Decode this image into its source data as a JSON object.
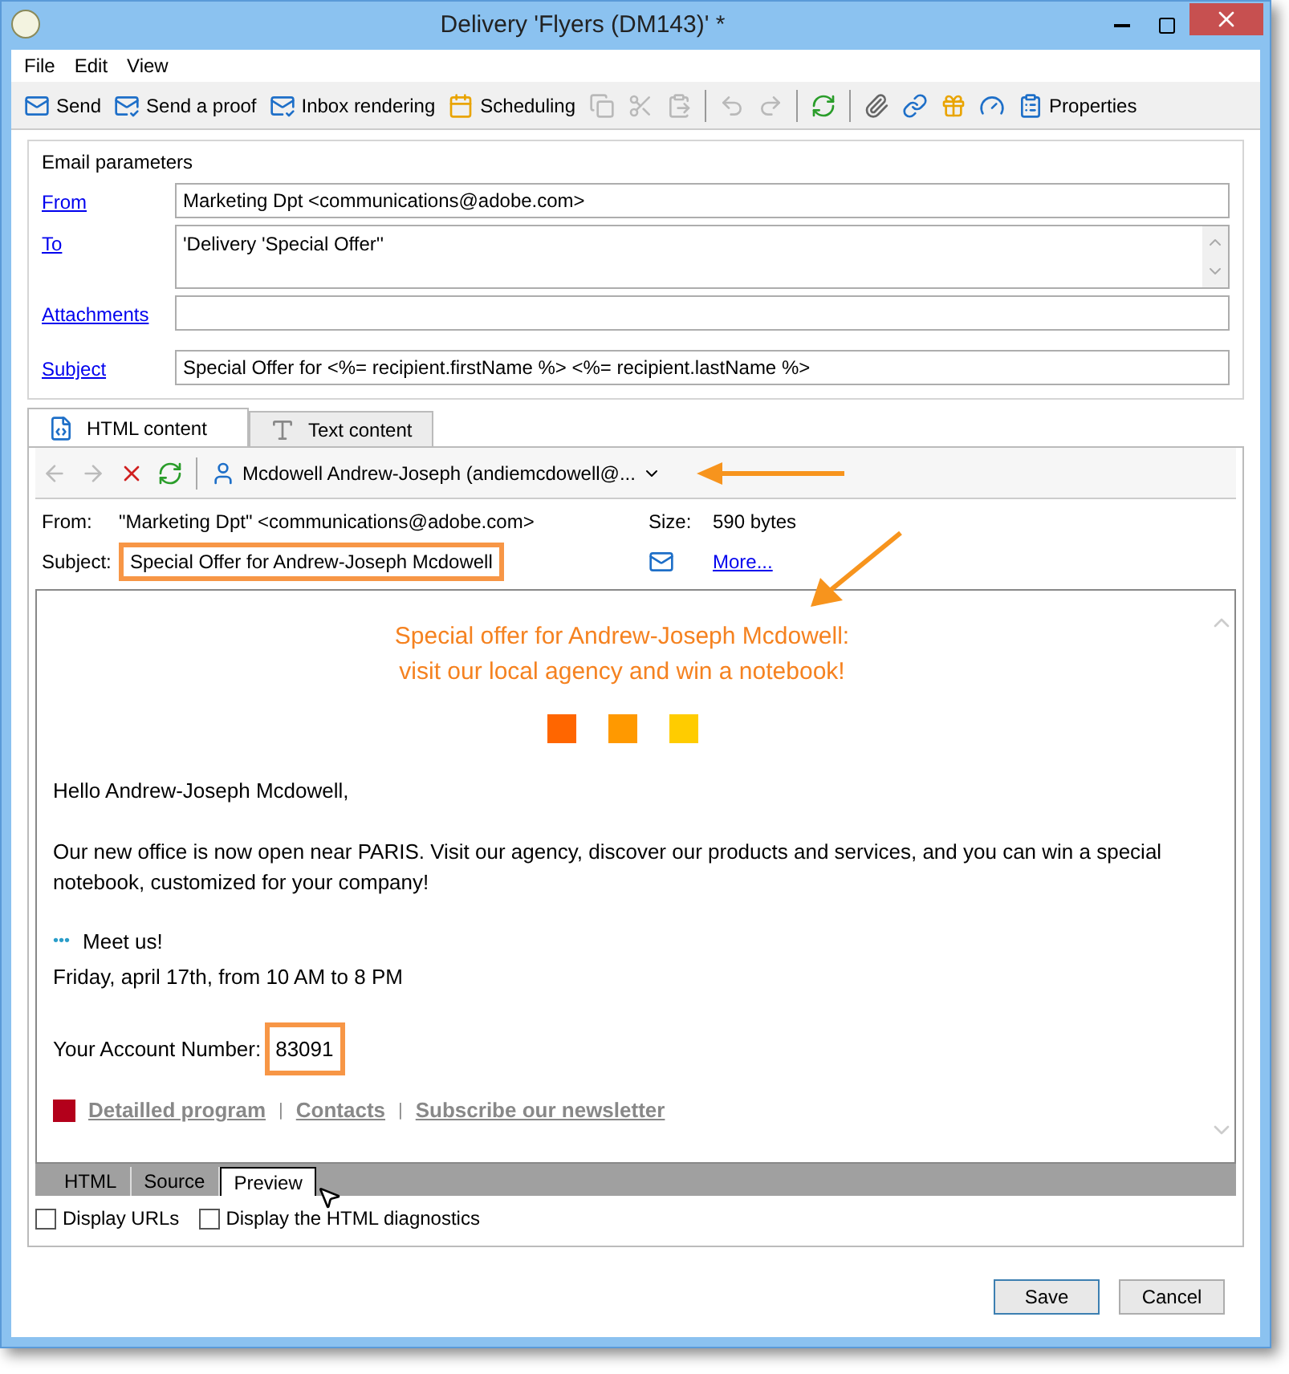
{
  "window": {
    "title": "Delivery 'Flyers (DM143)' *"
  },
  "menu": [
    "File",
    "Edit",
    "View"
  ],
  "toolbar": [
    {
      "kind": "mail",
      "label": "Send",
      "disabled": false
    },
    {
      "kind": "mail-check",
      "label": "Send a proof",
      "disabled": false
    },
    {
      "kind": "mail-check",
      "label": "Inbox rendering",
      "disabled": false
    },
    {
      "kind": "calendar",
      "label": "Scheduling",
      "disabled": false
    },
    {
      "kind": "copy",
      "disabled": true
    },
    {
      "kind": "cut",
      "disabled": true
    },
    {
      "kind": "paste",
      "disabled": true
    },
    {
      "kind": "sep"
    },
    {
      "kind": "undo",
      "disabled": true
    },
    {
      "kind": "redo",
      "disabled": true
    },
    {
      "kind": "sep"
    },
    {
      "kind": "refresh",
      "disabled": false
    },
    {
      "kind": "sep"
    },
    {
      "kind": "paperclip",
      "disabled": false
    },
    {
      "kind": "link",
      "disabled": false
    },
    {
      "kind": "gift",
      "disabled": false
    },
    {
      "kind": "gauge",
      "disabled": false
    },
    {
      "kind": "clipboard",
      "label": "Properties",
      "disabled": false
    }
  ],
  "email_parameters": {
    "title": "Email parameters",
    "fields": [
      {
        "label": "From",
        "value": "Marketing Dpt <communications@adobe.com>",
        "kind": "line"
      },
      {
        "label": "To",
        "value": "'Delivery 'Special Offer''",
        "kind": "multi"
      },
      {
        "label": "Attachments",
        "kind": "line"
      },
      {
        "label": "Subject",
        "value": "Special Offer for <%= recipient.firstName %> <%= recipient.lastName %>",
        "kind": "line"
      }
    ]
  },
  "content_tabs": [
    {
      "label": "HTML content",
      "selected": true,
      "kind": "html"
    },
    {
      "label": "Text content",
      "selected": false,
      "kind": "text"
    }
  ],
  "preview_toolbar": {
    "recipient": "Mcdowell Andrew-Joseph (andiemcdowell@..."
  },
  "header": {
    "from_label": "From:",
    "from": "\"Marketing Dpt\" <communications@adobe.com>",
    "subject_label": "Subject:",
    "subject": "Special Offer for Andrew-Joseph Mcdowell",
    "subject_highlighted": true,
    "size_label": "Size:",
    "size": "590 bytes",
    "more": "More..."
  },
  "email_body": {
    "headline": [
      "Special offer for Andrew-Joseph Mcdowell:",
      "visit our local agency and win a notebook!"
    ],
    "squares": [
      {
        "color": "#ff6600"
      },
      {
        "color": "#ff9900"
      },
      {
        "color": "#ffcc00"
      }
    ],
    "greeting": "Hello Andrew-Joseph Mcdowell,",
    "paragraph": "Our new office is now open near PARIS. Visit our agency, discover our products and services, and you can win a special notebook, customized for your company!",
    "bullet": "•••",
    "meet": "Meet us!",
    "date": "Friday, april 17th, from 10 AM to 8 PM",
    "account_label": "Your Account Number:",
    "account_number": "83091",
    "account_highlighted": true,
    "links": [
      "Detailled program",
      "Contacts",
      "Subscribe our newsletter"
    ],
    "link_separator": "|"
  },
  "view_tabs": [
    {
      "label": "HTML",
      "selected": false
    },
    {
      "label": "Source",
      "selected": false
    },
    {
      "label": "Preview",
      "selected": true
    }
  ],
  "options": [
    {
      "label": "Display URLs",
      "checked": false
    },
    {
      "label": "Display the HTML diagnostics",
      "checked": false
    }
  ],
  "buttons": [
    {
      "label": "Save",
      "default": true
    },
    {
      "label": "Cancel",
      "default": false
    }
  ]
}
